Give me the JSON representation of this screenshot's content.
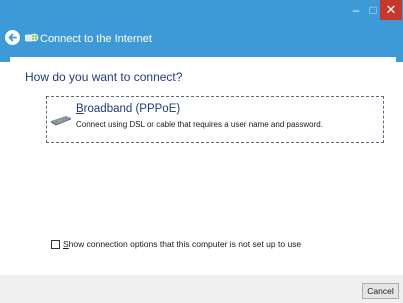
{
  "window": {
    "title": "Connect to the Internet",
    "minimize_glyph": "–",
    "maximize_glyph": "□",
    "close_glyph": "✕"
  },
  "main": {
    "heading": "How do you want to connect?"
  },
  "option": {
    "title_accel": "B",
    "title_rest": "roadband (PPPoE)",
    "description": "Connect using DSL or cable that requires a user name and password."
  },
  "checkbox": {
    "label_accel": "S",
    "label_rest": "how connection options that this computer is not set up to use"
  },
  "footer": {
    "cancel_label": "Cancel"
  },
  "colors": {
    "titlebar": "#3e9ad7",
    "heading": "#1f3d7a",
    "close": "#c7372c"
  },
  "icons": [
    "back-arrow-icon",
    "network-globe-icon",
    "modem-icon",
    "minimize-icon",
    "maximize-icon",
    "close-icon"
  ]
}
